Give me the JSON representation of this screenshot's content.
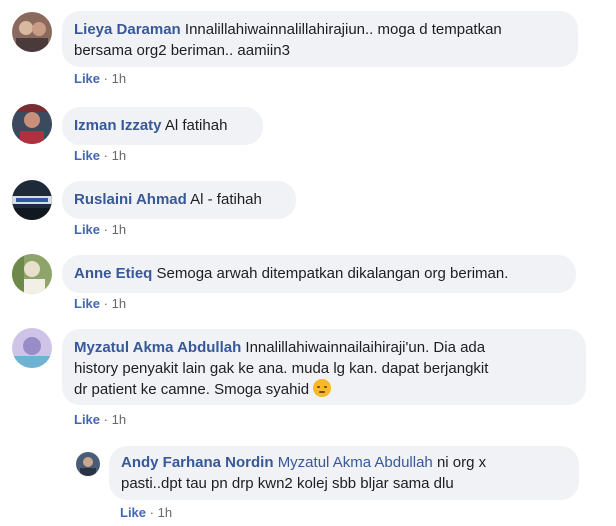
{
  "comments": [
    {
      "author": "Lieya Daraman",
      "text_line1": "Innalillahiwainnalillahirajiun.. moga d tempatkan",
      "text_line2": "bersama org2 beriman.. aamiin3",
      "like_label": "Like",
      "separator": "·",
      "time": "1h"
    },
    {
      "author": "Izman Izzaty",
      "text": "Al fatihah",
      "like_label": "Like",
      "separator": "·",
      "time": "1h"
    },
    {
      "author": "Ruslaini Ahmad",
      "text": "Al - fatihah",
      "like_label": "Like",
      "separator": "·",
      "time": "1h"
    },
    {
      "author": "Anne Etieq",
      "text": "Semoga arwah ditempatkan dikalangan org beriman.",
      "like_label": "Like",
      "separator": "·",
      "time": "1h"
    },
    {
      "author": "Myzatul Akma Abdullah",
      "text_line1": "Innalillahiwainnailaihiraji'un. Dia ada",
      "text_line2": "history penyakit lain gak ke ana. muda lg kan. dapat berjangkit",
      "text_line3": "dr patient ke camne. Smoga syahid",
      "emoji": "pensive-face-emoji",
      "like_label": "Like",
      "separator": "·",
      "time": "1h"
    }
  ],
  "reply": {
    "author": "Andy Farhana Nordin",
    "mention": "Myzatul Akma Abdullah",
    "text_line1": "ni org x",
    "text_line2": "pasti..dpt tau pn drp kwn2 kolej sbb bljar sama dlu",
    "like_label": "Like",
    "separator": "·",
    "time": "1h"
  },
  "colors": {
    "author": "#385898",
    "bubble": "#f0f2f5",
    "like": "#4267b2",
    "meta": "#65676b"
  }
}
